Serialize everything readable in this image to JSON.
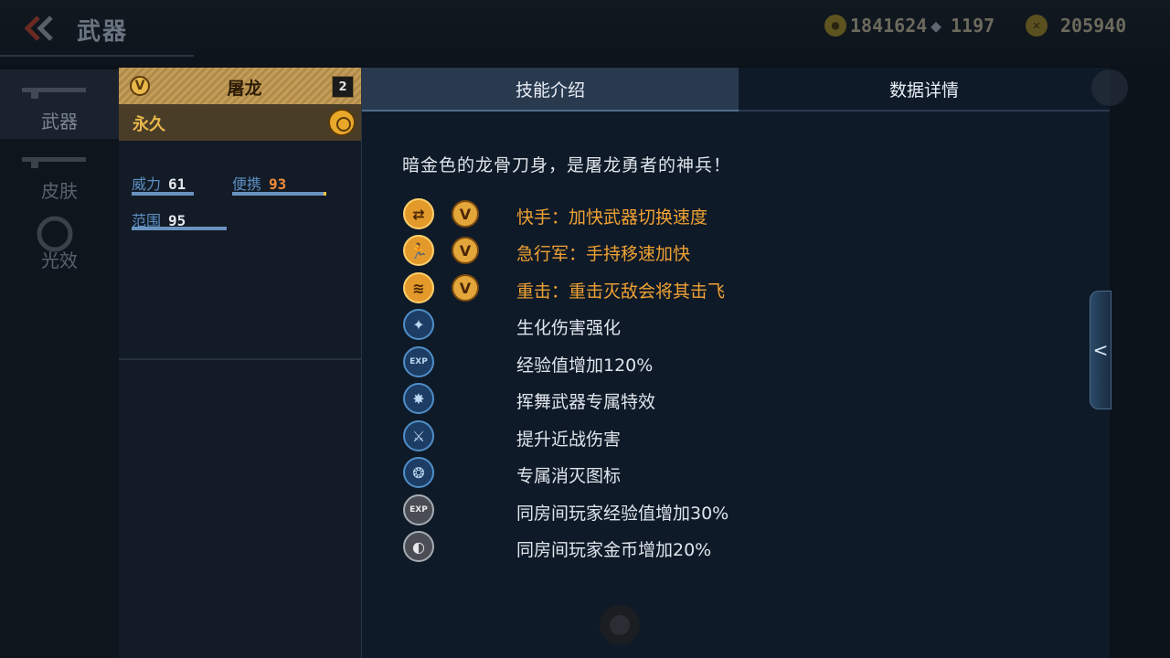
{
  "header": {
    "back_icon": "double-chevron-left-icon",
    "title": "武器",
    "currencies": [
      {
        "icon": "coin-icon",
        "value": "1841624"
      },
      {
        "icon": "diamond-icon",
        "value": "1197"
      },
      {
        "icon": "token-icon",
        "value": "205940"
      }
    ]
  },
  "nav": {
    "items": [
      {
        "label": "武器",
        "active": true
      },
      {
        "label": "皮肤",
        "active": false
      },
      {
        "label": "光效",
        "active": false
      }
    ]
  },
  "weapon": {
    "rank_badge": "V",
    "name": "屠龙",
    "level": "2",
    "duration": "永久",
    "stats": [
      {
        "label": "威力",
        "value": "61"
      },
      {
        "label": "便携",
        "value": "93"
      },
      {
        "label": "范围",
        "value": "95"
      }
    ]
  },
  "tabs": {
    "skill": "技能介绍",
    "data": "数据详情"
  },
  "description": "暗金色的龙骨刀身，是屠龙勇者的神兵！",
  "skills": [
    {
      "icon": "swap-icon",
      "glyph": "⇄",
      "style": "gold",
      "v_badge": "V",
      "text": "快手：加快武器切换速度"
    },
    {
      "icon": "run-icon",
      "glyph": "🏃",
      "style": "gold",
      "v_badge": "V",
      "text": "急行军：手持移速加快"
    },
    {
      "icon": "impact-icon",
      "glyph": "≋",
      "style": "gold",
      "v_badge": "V",
      "text": "重击：重击灭敌会将其击飞"
    },
    {
      "icon": "bio-damage-icon",
      "glyph": "✦",
      "style": "blue",
      "v_badge": "",
      "text": "生化伤害强化"
    },
    {
      "icon": "exp-icon",
      "glyph": "EXP",
      "style": "blue",
      "v_badge": "",
      "text": "经验值增加120%"
    },
    {
      "icon": "swing-effect-icon",
      "glyph": "✸",
      "style": "blue",
      "v_badge": "",
      "text": "挥舞武器专属特效"
    },
    {
      "icon": "melee-icon",
      "glyph": "⚔",
      "style": "blue",
      "v_badge": "",
      "text": "提升近战伤害"
    },
    {
      "icon": "kill-icon",
      "glyph": "❂",
      "style": "blue",
      "v_badge": "",
      "text": "专属消灭图标"
    },
    {
      "icon": "room-exp-icon",
      "glyph": "EXP",
      "style": "grey",
      "v_badge": "",
      "text": "同房间玩家经验值增加30%"
    },
    {
      "icon": "room-coin-icon",
      "glyph": "◐",
      "style": "grey",
      "v_badge": "",
      "text": "同房间玩家金币增加20%"
    }
  ],
  "side_toggle": "<",
  "colors": {
    "gold": "#f0a233",
    "accent_blue": "#5d8fc2",
    "highlight_orange": "#f08a3a"
  }
}
